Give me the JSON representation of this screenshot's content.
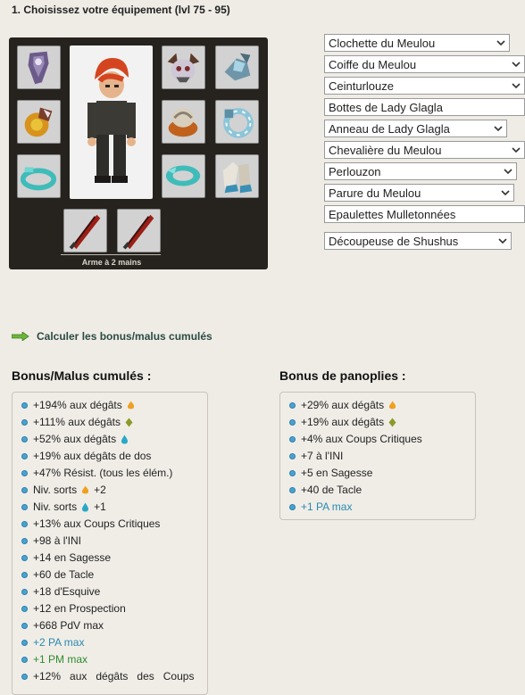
{
  "page": {
    "title": "1. Choisissez votre équipement (lvl 75 - 95)"
  },
  "equipment": {
    "weapon_label": "Arme à 2 mains",
    "selects": [
      "Clochette du Meulou",
      "Coiffe du Meulou",
      "Ceinturlouze",
      "Bottes de Lady Glagla",
      "Anneau de Lady Glagla",
      "Chevalière du Meulou",
      "Perlouzon",
      "Parure du Meulou",
      "Epaulettes Mulletonnées",
      "Découpeuse de Shushus"
    ]
  },
  "calc_link": "Calculer les bonus/malus cumulés",
  "bonus_cumules": {
    "title": "Bonus/Malus cumulés :",
    "items": [
      {
        "text": "+194% aux dégâts",
        "icon": "fire-icon"
      },
      {
        "text": "+111% aux dégâts",
        "icon": "earth-icon"
      },
      {
        "text": "+52% aux dégâts",
        "icon": "water-icon"
      },
      {
        "text": "+19% aux dégâts de dos"
      },
      {
        "text": "+47% Résist. (tous les élém.)"
      },
      {
        "text": "Niv. sorts",
        "icon": "fire-icon",
        "suffix": "+2"
      },
      {
        "text": "Niv. sorts",
        "icon": "water-icon",
        "suffix": "+1"
      },
      {
        "text": "+13% aux Coups Critiques"
      },
      {
        "text": "+98 à l'INI"
      },
      {
        "text": "+14 en Sagesse"
      },
      {
        "text": "+60 de Tacle"
      },
      {
        "text": "+18 d'Esquive"
      },
      {
        "text": "+12 en Prospection"
      },
      {
        "text": "+668 PdV max"
      },
      {
        "text": "+2 PA max",
        "style": "blue"
      },
      {
        "text": "+1 PM max",
        "style": "green"
      },
      {
        "text": "+12%   aux   dégâts   des   Coups"
      }
    ]
  },
  "bonus_panoplies": {
    "title": "Bonus de panoplies :",
    "items": [
      {
        "text": "+29% aux dégâts",
        "icon": "fire-icon"
      },
      {
        "text": "+19% aux dégâts",
        "icon": "earth-icon"
      },
      {
        "text": "+4% aux Coups Critiques"
      },
      {
        "text": "+7 à l'INI"
      },
      {
        "text": "+5 en Sagesse"
      },
      {
        "text": "+40 de Tacle"
      },
      {
        "text": "+1 PA max",
        "style": "blue"
      }
    ]
  },
  "colors": {
    "panel": "#26231f",
    "link": "#2c4a44",
    "bullet": "#4aa3cf",
    "pa": "#2a8ab0",
    "pm": "#2e8b2e"
  }
}
